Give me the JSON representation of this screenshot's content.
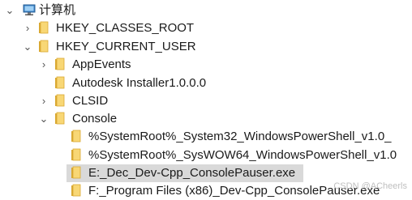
{
  "tree": {
    "root_label": "计算机",
    "hkcr_label": "HKEY_CLASSES_ROOT",
    "hkcu_label": "HKEY_CURRENT_USER",
    "appevents_label": "AppEvents",
    "autodesk_label": "Autodesk Installer1.0.0.0",
    "clsid_label": "CLSID",
    "console_label": "Console",
    "console_child1_label": "%SystemRoot%_System32_WindowsPowerShell_v1.0_",
    "console_child2_label": "%SystemRoot%_SysWOW64_WindowsPowerShell_v1.0",
    "console_child3_label": "E:_Dec_Dev-Cpp_ConsolePauser.exe",
    "console_child4_label": "F:_Program Files (x86)_Dev-Cpp_ConsolePauser.exe",
    "selected_item": "E:_Dec_Dev-Cpp_ConsolePauser.exe"
  },
  "watermark": "CSDN @ACheerls",
  "colors": {
    "folder_fill": "#f8d775",
    "folder_edge": "#d9a932",
    "selected_bg": "#d9d9d9",
    "chevron": "#555555"
  },
  "icons": {
    "expanded": "chevron-down-icon",
    "collapsed": "chevron-right-icon",
    "folder": "folder-icon",
    "computer": "computer-icon"
  }
}
